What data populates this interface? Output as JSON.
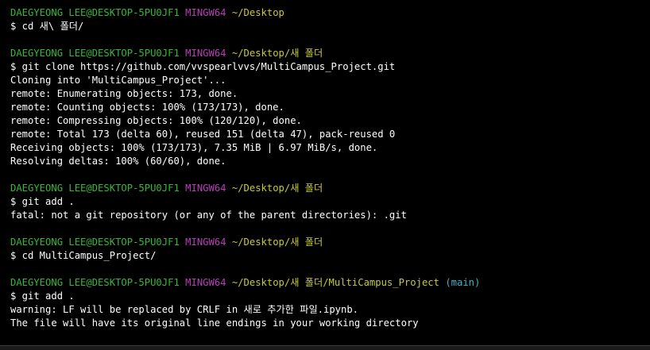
{
  "terminal": {
    "user": "DAEGYEONG LEE@DESKTOP-5PU0JF1",
    "system": "MINGW64",
    "blocks": [
      {
        "path": "~/Desktop",
        "branch": "",
        "command": "$ cd 새\\ 폴더/",
        "output": []
      },
      {
        "path": "~/Desktop/새 폴더",
        "branch": "",
        "command": "$ git clone https://github.com/vvspearlvvs/MultiCampus_Project.git",
        "output": [
          "Cloning into 'MultiCampus_Project'...",
          "remote: Enumerating objects: 173, done.",
          "remote: Counting objects: 100% (173/173), done.",
          "remote: Compressing objects: 100% (120/120), done.",
          "remote: Total 173 (delta 60), reused 151 (delta 47), pack-reused 0",
          "Receiving objects: 100% (173/173), 7.35 MiB | 6.97 MiB/s, done.",
          "Resolving deltas: 100% (60/60), done."
        ]
      },
      {
        "path": "~/Desktop/새 폴더",
        "branch": "",
        "command": "$ git add .",
        "output": [
          "fatal: not a git repository (or any of the parent directories): .git"
        ]
      },
      {
        "path": "~/Desktop/새 폴더",
        "branch": "",
        "command": "$ cd MultiCampus_Project/",
        "output": []
      },
      {
        "path": "~/Desktop/새 폴더/MultiCampus_Project",
        "branch": "(main)",
        "command": "$ git add .",
        "output": [
          "warning: LF will be replaced by CRLF in 새로 추가한 파일.ipynb.",
          "The file will have its original line endings in your working directory"
        ]
      }
    ]
  }
}
